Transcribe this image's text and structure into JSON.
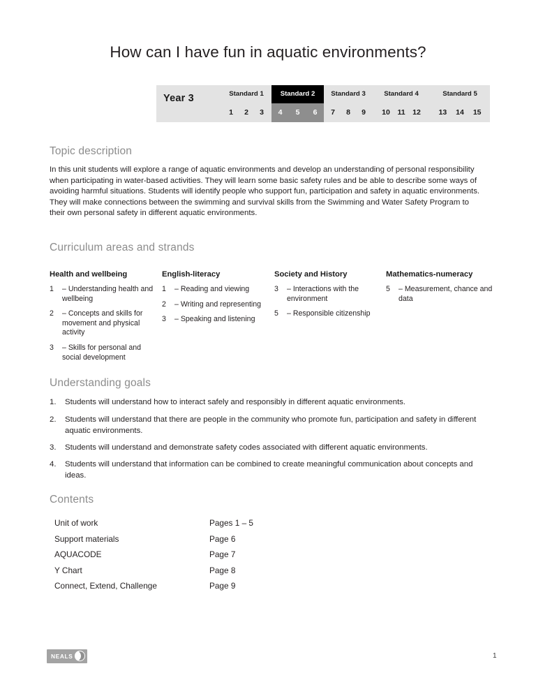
{
  "document": {
    "title": "How can I have fun in aquatic environments?",
    "page_number": "1"
  },
  "standards_table": {
    "year_label": "Year 3",
    "active_standard": "Standard 2",
    "standards": [
      {
        "label": "Standard 1",
        "active": false,
        "numbers": [
          "1",
          "2",
          "3"
        ]
      },
      {
        "label": "Standard 2",
        "active": true,
        "numbers": [
          "4",
          "5",
          "6"
        ]
      },
      {
        "label": "Standard 3",
        "active": false,
        "numbers": [
          "7",
          "8",
          "9"
        ]
      },
      {
        "label": "Standard 4",
        "active": false,
        "numbers": [
          "10",
          "11",
          "12"
        ]
      },
      {
        "label": "Standard 5",
        "active": false,
        "numbers": [
          "13",
          "14",
          "15"
        ]
      }
    ],
    "colors": {
      "background": "#e3e3e3",
      "active_header": "#000000",
      "active_numbers": "#8e8e8e"
    }
  },
  "topic_description": {
    "heading": "Topic description",
    "body": "In this unit students will explore a range of aquatic environments and develop an understanding of personal responsibility when participating in water-based activities. They will learn some basic safety rules and be able to describe some ways of avoiding harmful situations.  Students will identify people who support fun, participation and safety in aquatic environments. They will make connections between the swimming and survival skills from the Swimming and Water Safety Program to their own personal safety in different aquatic environments."
  },
  "curriculum": {
    "heading": "Curriculum areas and strands",
    "columns": [
      {
        "title": "Health and wellbeing",
        "items": [
          {
            "num": "1",
            "dash": "–",
            "text": "Understanding health and wellbeing"
          },
          {
            "num": "2",
            "dash": "–",
            "text": "Concepts and skills for movement and physical activity"
          },
          {
            "num": "3",
            "dash": "–",
            "text": "Skills for personal and social development"
          }
        ]
      },
      {
        "title": "English-literacy",
        "items": [
          {
            "num": "1",
            "dash": "–",
            "text": "Reading and viewing"
          },
          {
            "num": "2",
            "dash": "–",
            "text": "Writing and representing"
          },
          {
            "num": "3",
            "dash": "–",
            "text": "Speaking and listening"
          }
        ]
      },
      {
        "title": "Society and History",
        "items": [
          {
            "num": "3",
            "dash": "–",
            "text": "Interactions with the environment"
          },
          {
            "num": "5",
            "dash": "–",
            "text": "Responsible citizenship"
          }
        ]
      },
      {
        "title": "Mathematics-numeracy",
        "items": [
          {
            "num": "5",
            "dash": "–",
            "text": "Measurement, chance and data"
          }
        ]
      }
    ]
  },
  "understanding_goals": {
    "heading": "Understanding goals",
    "goals": [
      {
        "num": "1.",
        "text": "Students will understand how to interact safely and responsibly in different aquatic environments."
      },
      {
        "num": "2.",
        "text": "Students will understand that there are people in the community who promote fun, participation and safety in different aquatic environments."
      },
      {
        "num": "3.",
        "text": "Students will understand and demonstrate safety codes associated with different aquatic environments."
      },
      {
        "num": "4.",
        "text": "Students will understand that information can be combined to create meaningful communication about concepts and ideas."
      }
    ]
  },
  "contents": {
    "heading": "Contents",
    "rows": [
      {
        "item": "Unit of work",
        "pages": "Pages 1 –  5"
      },
      {
        "item": "Support materials",
        "pages": "Page 6"
      },
      {
        "item": "AQUACODE",
        "pages": "Page 7"
      },
      {
        "item": "Y Chart",
        "pages": "Page 8"
      },
      {
        "item": "Connect, Extend, Challenge",
        "pages": "Page 9"
      }
    ]
  },
  "footer": {
    "neals_logo_text": "NEALS"
  }
}
